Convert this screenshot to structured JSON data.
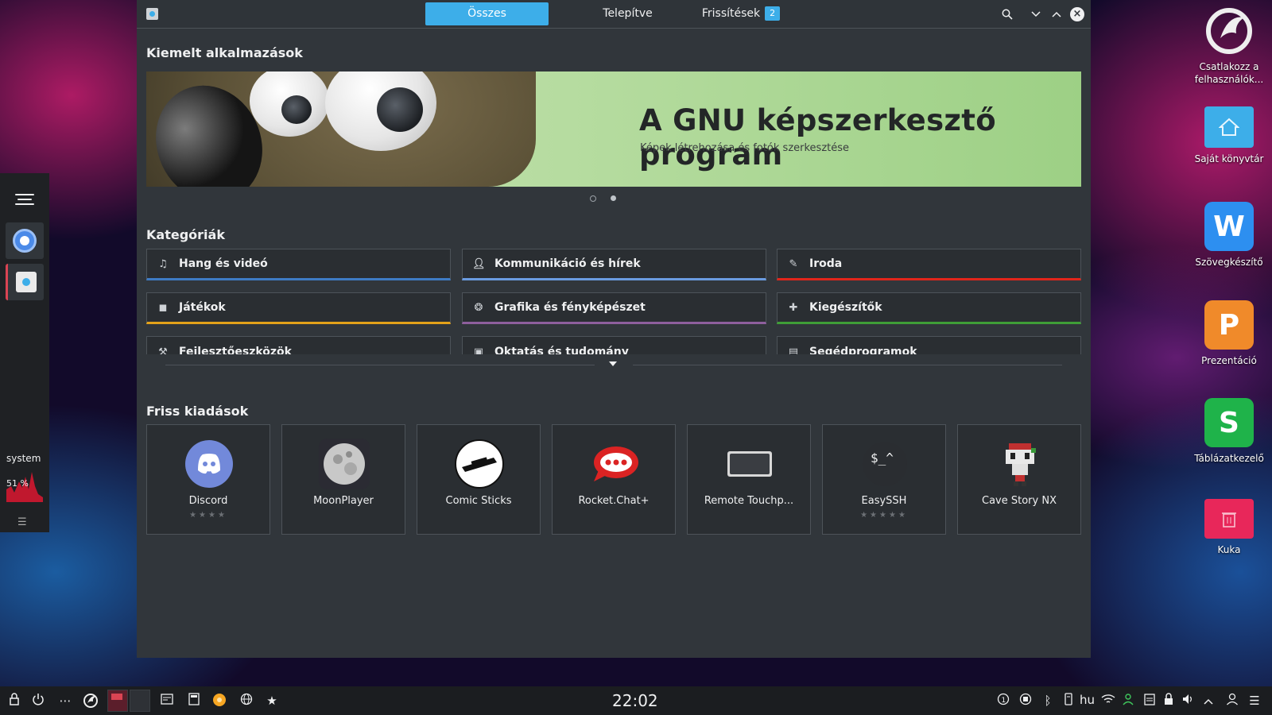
{
  "window": {
    "tabs": [
      {
        "label": "Összes"
      },
      {
        "label": "Telepítve"
      },
      {
        "label": "Frissítések",
        "badge": "2"
      }
    ]
  },
  "featured": {
    "title": "Kiemelt alkalmazások",
    "banner_title": "A GNU képszerkesztő program",
    "banner_subtitle": "Képek létrehozása és fotók szerkesztése",
    "pages": 2,
    "current_page": 2
  },
  "categories": {
    "title": "Kategóriák",
    "items": [
      {
        "label": "Hang és videó",
        "icon": "music-note-icon",
        "color": "#3e7bc4"
      },
      {
        "label": "Kommunikáció és hírek",
        "icon": "user-icon",
        "color": "#6a9be0"
      },
      {
        "label": "Iroda",
        "icon": "edit-icon",
        "color": "#e0251b"
      },
      {
        "label": "Játékok",
        "icon": "gamepad-icon",
        "color": "#e3a21a"
      },
      {
        "label": "Grafika és fényképészet",
        "icon": "graphics-icon",
        "color": "#8e5f9d"
      },
      {
        "label": "Kiegészítők",
        "icon": "puzzle-icon",
        "color": "#3f9e37"
      },
      {
        "label": "Fejlesztőeszközök",
        "icon": "tools-icon",
        "color": "#4d5359"
      },
      {
        "label": "Oktatás és tudomány",
        "icon": "book-icon",
        "color": "#4d5359"
      },
      {
        "label": "Segédprogramok",
        "icon": "utility-icon",
        "color": "#4d5359"
      }
    ]
  },
  "new_releases": {
    "title": "Friss kiadások",
    "apps": [
      {
        "name": "Discord",
        "rating": "★★★★"
      },
      {
        "name": "MoonPlayer",
        "rating": ""
      },
      {
        "name": "Comic Sticks",
        "rating": ""
      },
      {
        "name": "Rocket.Chat+",
        "rating": ""
      },
      {
        "name": "Remote Touchp...",
        "rating": ""
      },
      {
        "name": "EasySSH",
        "rating": "★★★★★"
      },
      {
        "name": "Cave Story NX",
        "rating": ""
      }
    ]
  },
  "desktop": {
    "icons": [
      {
        "label": "Csatlakozz a felhasználók..."
      },
      {
        "label": "Saját könyvtár"
      },
      {
        "label": "Szövegkészítő"
      },
      {
        "label": "Prezentáció"
      },
      {
        "label": "Táblázatkezelő"
      },
      {
        "label": "Kuka"
      }
    ]
  },
  "sysmon": {
    "label": "system",
    "percent": "51 %"
  },
  "taskbar": {
    "clock": "22:02",
    "lang": "hu"
  }
}
